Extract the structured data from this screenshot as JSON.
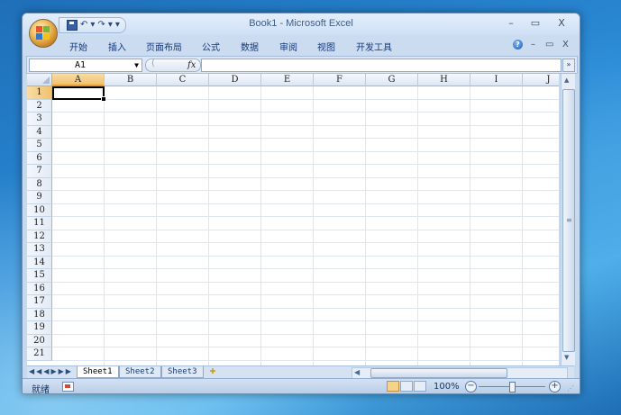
{
  "app": {
    "title": "Book1 - Microsoft Excel"
  },
  "window_controls": {
    "minimize": "–",
    "restore": "▭",
    "close": "X"
  },
  "quick_access": {
    "undo": "↶",
    "redo": "↷",
    "dropdown": "▾",
    "separator": "-"
  },
  "ribbon": {
    "tabs": [
      "开始",
      "插入",
      "页面布局",
      "公式",
      "数据",
      "审阅",
      "视图",
      "开发工具"
    ],
    "help": "?",
    "mini_minimize": "–",
    "mini_restore": "▭",
    "mini_close": "X"
  },
  "formula_bar": {
    "name_box": "A1",
    "fx": "fx",
    "value": ""
  },
  "grid": {
    "columns": [
      "A",
      "B",
      "C",
      "D",
      "E",
      "F",
      "G",
      "H",
      "I",
      "J"
    ],
    "rows": [
      "1",
      "2",
      "3",
      "4",
      "5",
      "6",
      "7",
      "8",
      "9",
      "10",
      "11",
      "12",
      "13",
      "14",
      "15",
      "16",
      "17",
      "18",
      "19",
      "20",
      "21"
    ],
    "active_cell": "A1"
  },
  "sheets": {
    "tabs": [
      "Sheet1",
      "Sheet2",
      "Sheet3"
    ],
    "active": "Sheet1"
  },
  "status": {
    "ready": "就绪",
    "zoom": "100%"
  },
  "colors": {
    "accent": "#1d3f78",
    "active_header": "#f1c16c",
    "gridline": "#dfe6f0"
  },
  "icons": {
    "office": "office-logo-icon",
    "save": "save-icon",
    "undo": "undo-icon",
    "redo": "redo-icon",
    "help": "help-icon",
    "macro": "record-macro-icon",
    "new_sheet": "insert-sheet-icon"
  }
}
